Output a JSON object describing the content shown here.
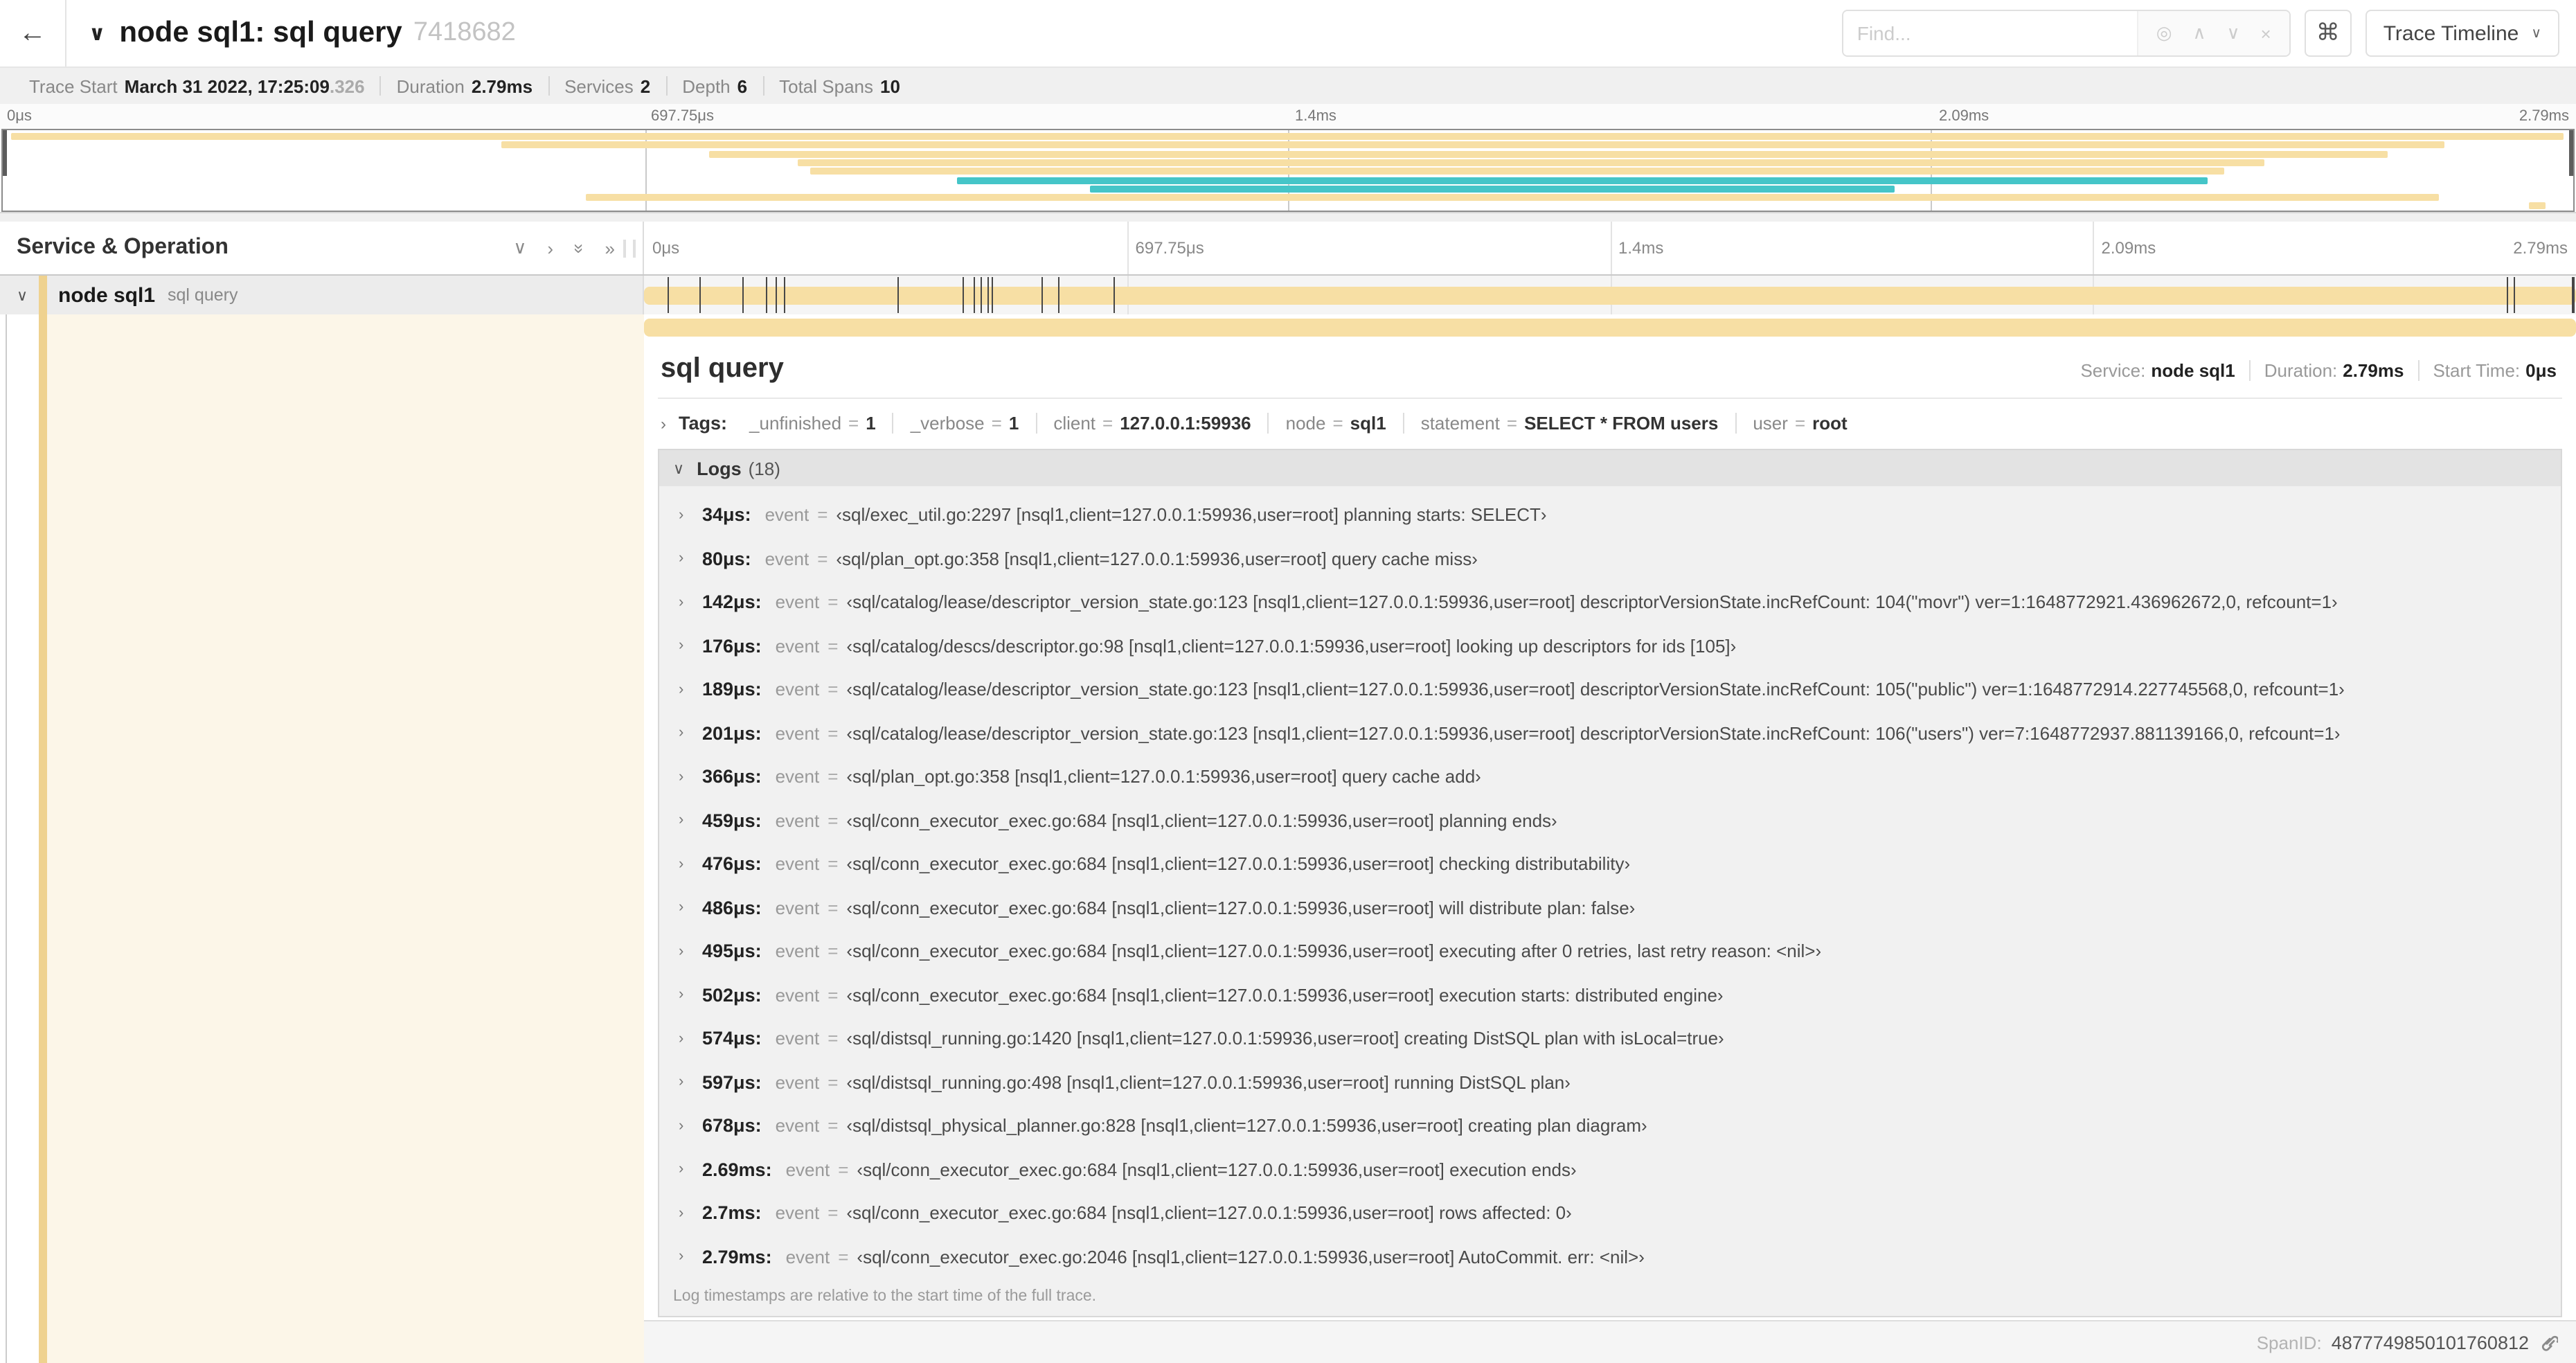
{
  "header": {
    "title": "node sql1: sql query",
    "trace_id": "7418682",
    "find_placeholder": "Find...",
    "view_select_label": "Trace Timeline"
  },
  "icons": {
    "back": "←",
    "chevron_down": "∨",
    "chevron_right": "›",
    "double_chevron": "»",
    "target": "◎",
    "up": "∧",
    "down": "∨",
    "close": "×",
    "command": "⌘"
  },
  "stats": [
    {
      "label": "Trace Start",
      "value": "March 31 2022, 17:25:09",
      "suffix": ".326"
    },
    {
      "label": "Duration",
      "value": "2.79ms"
    },
    {
      "label": "Services",
      "value": "2"
    },
    {
      "label": "Depth",
      "value": "6"
    },
    {
      "label": "Total Spans",
      "value": "10"
    }
  ],
  "timeline": {
    "duration_us": 2790,
    "ticks": [
      "0μs",
      "697.75μs",
      "1.4ms",
      "2.09ms",
      "2.79ms"
    ],
    "minimap_spans": [
      {
        "start": 0.3,
        "end": 99.6,
        "color": "tan"
      },
      {
        "start": 19.4,
        "end": 95.0,
        "color": "tan"
      },
      {
        "start": 27.5,
        "end": 92.8,
        "color": "tan"
      },
      {
        "start": 30.9,
        "end": 88.0,
        "color": "tan"
      },
      {
        "start": 31.4,
        "end": 86.4,
        "color": "tan"
      },
      {
        "start": 37.1,
        "end": 85.8,
        "color": "teal"
      },
      {
        "start": 42.3,
        "end": 73.6,
        "color": "teal"
      },
      {
        "start": 22.7,
        "end": 94.8,
        "color": "tan"
      },
      {
        "start": 98.3,
        "end": 98.9,
        "color": "tan"
      }
    ]
  },
  "span_list": {
    "header_title": "Service & Operation",
    "row": {
      "service": "node sql1",
      "operation": "sql query"
    }
  },
  "detail": {
    "operation": "sql query",
    "eq": "=",
    "meta": [
      {
        "label": "Service:",
        "value": "node sql1"
      },
      {
        "label": "Duration:",
        "value": "2.79ms"
      },
      {
        "label": "Start Time:",
        "value": "0μs"
      }
    ],
    "tags_label": "Tags:",
    "tags": [
      {
        "key": "_unfinished",
        "value": "1"
      },
      {
        "key": "_verbose",
        "value": "1"
      },
      {
        "key": "client",
        "value": "127.0.0.1:59936"
      },
      {
        "key": "node",
        "value": "sql1"
      },
      {
        "key": "statement",
        "value": "SELECT * FROM users"
      },
      {
        "key": "user",
        "value": "root"
      }
    ],
    "logs_label": "Logs",
    "logs_count": "(18)",
    "log_field": "event",
    "logs": [
      {
        "t": "34μs:",
        "t_us": 34,
        "value": "‹sql/exec_util.go:2297 [nsql1,client=127.0.0.1:59936,user=root] planning starts: SELECT›"
      },
      {
        "t": "80μs:",
        "t_us": 80,
        "value": "‹sql/plan_opt.go:358 [nsql1,client=127.0.0.1:59936,user=root] query cache miss›"
      },
      {
        "t": "142μs:",
        "t_us": 142,
        "value": "‹sql/catalog/lease/descriptor_version_state.go:123 [nsql1,client=127.0.0.1:59936,user=root] descriptorVersionState.incRefCount: 104(\"movr\") ver=1:1648772921.436962672,0, refcount=1›"
      },
      {
        "t": "176μs:",
        "t_us": 176,
        "value": "‹sql/catalog/descs/descriptor.go:98 [nsql1,client=127.0.0.1:59936,user=root] looking up descriptors for ids [105]›"
      },
      {
        "t": "189μs:",
        "t_us": 189,
        "value": "‹sql/catalog/lease/descriptor_version_state.go:123 [nsql1,client=127.0.0.1:59936,user=root] descriptorVersionState.incRefCount: 105(\"public\") ver=1:1648772914.227745568,0, refcount=1›"
      },
      {
        "t": "201μs:",
        "t_us": 201,
        "value": "‹sql/catalog/lease/descriptor_version_state.go:123 [nsql1,client=127.0.0.1:59936,user=root] descriptorVersionState.incRefCount: 106(\"users\") ver=7:1648772937.881139166,0, refcount=1›"
      },
      {
        "t": "366μs:",
        "t_us": 366,
        "value": "‹sql/plan_opt.go:358 [nsql1,client=127.0.0.1:59936,user=root] query cache add›"
      },
      {
        "t": "459μs:",
        "t_us": 459,
        "value": "‹sql/conn_executor_exec.go:684 [nsql1,client=127.0.0.1:59936,user=root] planning ends›"
      },
      {
        "t": "476μs:",
        "t_us": 476,
        "value": "‹sql/conn_executor_exec.go:684 [nsql1,client=127.0.0.1:59936,user=root] checking distributability›"
      },
      {
        "t": "486μs:",
        "t_us": 486,
        "value": "‹sql/conn_executor_exec.go:684 [nsql1,client=127.0.0.1:59936,user=root] will distribute plan: false›"
      },
      {
        "t": "495μs:",
        "t_us": 495,
        "value": "‹sql/conn_executor_exec.go:684 [nsql1,client=127.0.0.1:59936,user=root] executing after 0 retries, last retry reason: <nil>›"
      },
      {
        "t": "502μs:",
        "t_us": 502,
        "value": "‹sql/conn_executor_exec.go:684 [nsql1,client=127.0.0.1:59936,user=root] execution starts: distributed engine›"
      },
      {
        "t": "574μs:",
        "t_us": 574,
        "value": "‹sql/distsql_running.go:1420 [nsql1,client=127.0.0.1:59936,user=root] creating DistSQL plan with isLocal=true›"
      },
      {
        "t": "597μs:",
        "t_us": 597,
        "value": "‹sql/distsql_running.go:498 [nsql1,client=127.0.0.1:59936,user=root] running DistSQL plan›"
      },
      {
        "t": "678μs:",
        "t_us": 678,
        "value": "‹sql/distsql_physical_planner.go:828 [nsql1,client=127.0.0.1:59936,user=root] creating plan diagram›"
      },
      {
        "t": "2.69ms:",
        "t_us": 2690,
        "value": "‹sql/conn_executor_exec.go:684 [nsql1,client=127.0.0.1:59936,user=root] execution ends›"
      },
      {
        "t": "2.7ms:",
        "t_us": 2700,
        "value": "‹sql/conn_executor_exec.go:684 [nsql1,client=127.0.0.1:59936,user=root] rows affected: 0›"
      },
      {
        "t": "2.79ms:",
        "t_us": 2790,
        "value": "‹sql/conn_executor_exec.go:2046 [nsql1,client=127.0.0.1:59936,user=root] AutoCommit. err: <nil>›"
      }
    ],
    "logs_note": "Log timestamps are relative to the start time of the full trace.",
    "spanid_label": "SpanID:",
    "spanid": "4877749850101760812"
  },
  "colors": {
    "tan": "#f7dfa4",
    "teal": "#45c5c8",
    "accent_stripe": "#efd28f",
    "cream": "#fcf6e8"
  }
}
